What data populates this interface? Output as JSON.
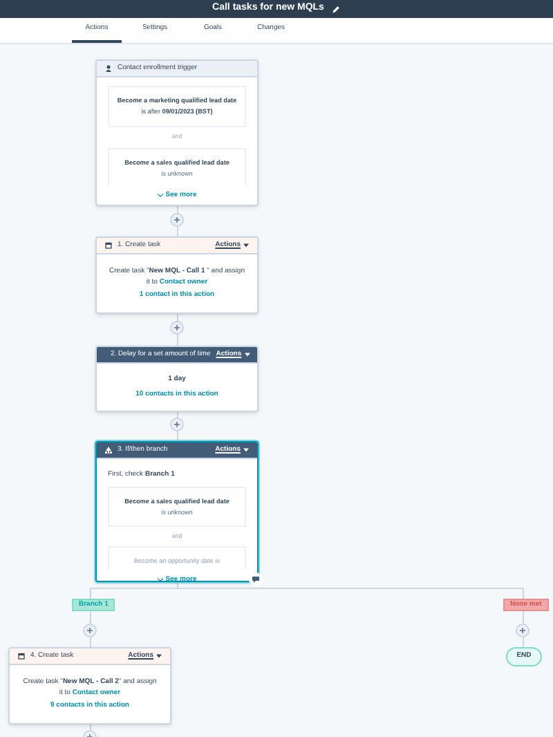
{
  "title": "Call tasks for new MQLs",
  "tabs": [
    {
      "label": "Actions",
      "selected": true
    },
    {
      "label": "Settings",
      "selected": false
    },
    {
      "label": "Goals",
      "selected": false
    },
    {
      "label": "Changes",
      "selected": false
    }
  ],
  "trigger": {
    "header": "Contact enrollment trigger",
    "conditions": [
      {
        "text": "**Become a marketing qualified lead date** is after **09/01/2023 (BST)**",
        "faded": false
      },
      {
        "text": "**Become a sales qualified lead date**",
        "sub": "is unknown",
        "faded": false
      }
    ],
    "joiner": "and",
    "see_more": "See more"
  },
  "actions": [
    {
      "kind": "task",
      "header": "1. Create task",
      "menu": "Actions",
      "body": "Create task \"**New MQL - Call 1** \" and assign it to",
      "owner": "Contact owner",
      "count": "1 contact in this action",
      "selected": false
    },
    {
      "kind": "delay",
      "header": "2. Delay for a set amount of time",
      "menu": "Actions",
      "body": "**1 day**",
      "count": "10 contacts in this action",
      "selected": false
    },
    {
      "kind": "branch",
      "header": "3. If/then branch",
      "menu": "Actions",
      "intro": "First, check **Branch 1**",
      "conditions": [
        {
          "text": "**Become a sales qualified lead date**",
          "sub": "is unknown",
          "faded": false
        },
        {
          "text": "Become an opportunity date is",
          "faded": true
        }
      ],
      "joiner": "and",
      "see_more": "See more",
      "selected": true
    }
  ],
  "branches": [
    {
      "label": "Branch 1",
      "color": "#a8e6d8"
    },
    {
      "label": "None met",
      "color": "#f2a9a9"
    }
  ],
  "branch_action": {
    "kind": "task",
    "header": "4. Create task",
    "menu": "Actions",
    "body": "Create task \"**New MQL - Call 2**\" and assign it to",
    "owner": "Contact owner",
    "count": "9 contacts in this action",
    "selected": false
  },
  "end": "END"
}
